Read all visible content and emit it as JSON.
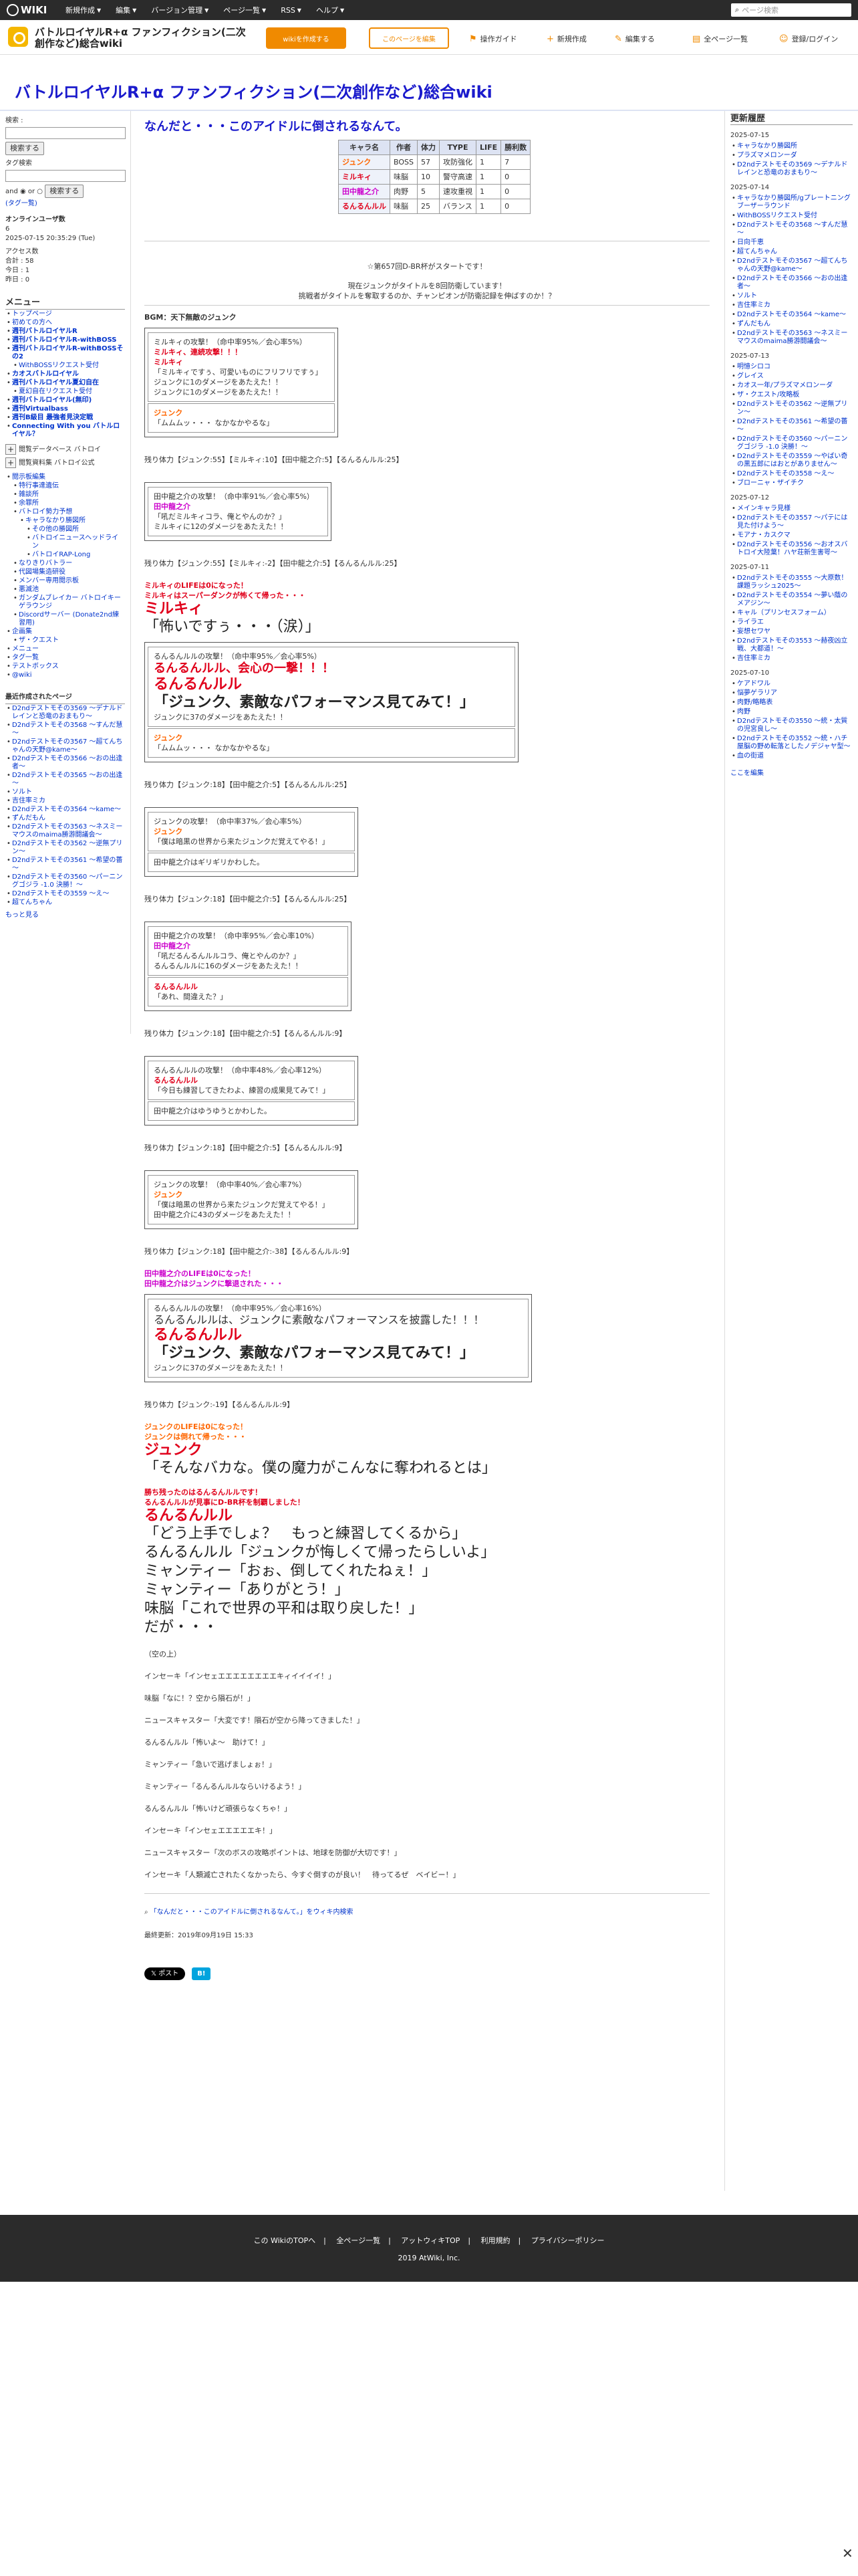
{
  "topbar": {
    "logo": "WIKI",
    "menus": [
      "新規作成",
      "編集",
      "バージョン管理",
      "ページ一覧",
      "RSS",
      "ヘルプ"
    ],
    "search_placeholder": "ページ検索"
  },
  "header": {
    "wiki_name": "バトルロイヤルR+α ファンフィクション(二次創作など)総合wiki",
    "btn_new_wiki": "wikiを作成する",
    "btn_edit_page": "このページを編集",
    "tools": [
      "操作ガイド",
      "新規作成",
      "編集する",
      "全ページ一覧",
      "登録/ログイン"
    ]
  },
  "page_title": "バトルロイヤルR+α ファンフィクション(二次創作など)総合wiki",
  "left": {
    "search_label": "検索 :",
    "search_btn": "検索する",
    "tag_label": "タグ検索",
    "tag_btn": "検索する",
    "and_or": "and ◉ or ○",
    "tag_cloud": "(タグ一覧)",
    "online_title": "オンラインユーザ数",
    "online_count": "6",
    "datetime": "2025-07-15 20:35:29 (Tue)",
    "access_title": "アクセス数",
    "access": [
      "合計 : 58",
      "今日 : 1",
      "昨日 : 0"
    ],
    "menu_title": "メニュー",
    "menu_items": [
      {
        "t": "トップページ",
        "b": false
      },
      {
        "t": "初めての方へ",
        "b": false
      },
      {
        "t": "週刊バトルロイヤルR",
        "b": true
      },
      {
        "t": "週刊バトルロイヤルR-withBOSS",
        "b": true
      },
      {
        "t": "週刊バトルロイヤルR-withBOSSその2",
        "b": true
      },
      {
        "t": "WithBOSSリクエスト受付",
        "b": false
      },
      {
        "t": "カオスバトルロイヤル",
        "b": true
      },
      {
        "t": "週刊バトルロイヤル夏幻自在",
        "b": true
      },
      {
        "t": "夏幻自在リクエスト受付",
        "b": false
      },
      {
        "t": "週刊バトルロイヤル(無印)",
        "b": true
      },
      {
        "t": "週刊Virtualbass",
        "b": true
      },
      {
        "t": "週刊B級目 最強者見決定戦",
        "b": true
      },
      {
        "t": "Connecting With you バトルロイヤル？",
        "b": true
      }
    ],
    "expand": "閲覧データベース バトロイ",
    "expand2": "閲覧資料集 バトロイ公式",
    "sub_items": [
      "閲示板編集",
      "特行事達遺伝",
      "雑談所",
      "余罪所",
      "バトロイ勢力予想",
      "キャラなかり勝図所",
      "その他の勝図所",
      "バトロイニュースヘッドライン",
      "バトロイRAP-Long",
      "なりきりバトラー",
      "代図場集造研役",
      "メンバー専用閲示板",
      "悪滅池",
      "ガンダムブレイカー バトロイキーゲラウンジ",
      "Discordサーバー (Donate2nd練習用)",
      "企画集",
      "ザ・クエスト",
      "メニュー",
      "タグ一覧",
      "テストボックス",
      "@wiki"
    ],
    "recent_title": "最近作成されたページ",
    "recent": [
      "D2ndテストモその3569 ～デナルドレインと恐竜のおまもり～",
      "D2ndテストモその3568 ～すんだ慧～",
      "D2ndテストモその3567 ～超てんちゃんの天野@kame～",
      "D2ndテストモその3566 ～おの出逢者～",
      "D2ndテストモその3565 ～おの出逢～",
      "ソルト",
      "吉住率ミカ",
      "D2ndテストモその3564 ～kame～",
      "ずんだもん",
      "D2ndテストモその3563 ～ネスミーマウスのmaima勝游闘議会～",
      "D2ndテストモその3562 ～逆無プリン～",
      "D2ndテストモその3561 ～希望の薔～",
      "D2ndテストモその3560 ～パーニングゴジラ -1.0 決勝！～",
      "D2ndテストモその3559 ～え～",
      "超てんちゃん"
    ],
    "more": "もっと見る"
  },
  "main": {
    "title": "なんだと・・・このアイドルに倒されるなんて。",
    "table": {
      "headers": [
        "キャラ名",
        "作者",
        "体力",
        "TYPE",
        "LIFE",
        "勝利数"
      ],
      "rows": [
        [
          "ジュンク",
          "BOSS",
          "57",
          "攻防強化",
          "1",
          "7"
        ],
        [
          "ミルキィ",
          "味脳",
          "10",
          "警守高速",
          "1",
          "0"
        ],
        [
          "田中龍之介",
          "肉野",
          "5",
          "速攻重視",
          "1",
          "0"
        ],
        [
          "るんるんルル",
          "味脳",
          "25",
          "バランス",
          "1",
          "0"
        ]
      ]
    },
    "start": "☆第657回D-BR杯がスタートです！",
    "current1": "現在ジュンクがタイトルを8回防衛しています！",
    "current2": "挑戦者がタイトルを奪取するのか、チャンピオンが防衛記録を伸ばすのか！？",
    "bgm": "BGM：天下無敵のジュンク",
    "box1": [
      "ミルキィの攻撃！（命中率95%／会心率5%）",
      "ミルキィ、連続攻撃！！！",
      "ミルキィ",
      "「ミルキィですぅ、可愛いものにフリフリですぅ」",
      "ジュンクに1のダメージをあたえた！！",
      "ジュンクに1のダメージをあたえた！！"
    ],
    "box1b": [
      "ジュンク",
      "「ムムムッ・・・ なかなかやるな」"
    ],
    "hp1": "残り体力【ジュンク:55】【ミルキィ:10】【田中龍之介:5】【るんるんルル:25】",
    "box2": [
      "田中龍之介の攻撃！（命中率91%／会心率5%）",
      "田中龍之介",
      "「吼だミルキィコラ、俺とやんのか？」",
      "ミルキィに12のダメージをあたえた！！"
    ],
    "hp2": "残り体力【ジュンク:55】【ミルキィ:-2】【田中龍之介:5】【るんるんルル:25】",
    "ko1a": "ミルキィのLIFEは0になった！",
    "ko1b": "ミルキィはスーパーダンクが怖くて帰った・・・",
    "ko1c": "ミルキィ",
    "ko1d": "「怖いですぅ・・・（涙）」",
    "box3": [
      "るんるんルルの攻撃！（命中率95%／会心率5%）",
      "るんるんルル、会心の一撃！！！",
      "るんるんルル",
      "「ジュンク、素敵なパフォーマンス見てみて！」",
      "ジュンクに37のダメージをあたえた！！"
    ],
    "box3b": [
      "ジュンク",
      "「ムムムッ・・・ なかなかやるな」"
    ],
    "hp3": "残り体力【ジュンク:18】【田中龍之介:5】【るんるんルル:25】",
    "box4": [
      "ジュンクの攻撃！（命中率37%／会心率5%）",
      "ジュンク",
      "「僕は暗黒の世界から来たジュンクだ覚えてやる！」"
    ],
    "box4b": "田中龍之介はギリギリかわした。",
    "hp4": "残り体力【ジュンク:18】【田中龍之介:5】【るんるんルル:25】",
    "box5": [
      "田中龍之介の攻撃！（命中率95%／会心率10%）",
      "田中龍之介",
      "「吼だるんるんルルコラ、俺とやんのか？」",
      "るんるんルルに16のダメージをあたえた！！"
    ],
    "box5b": [
      "るんるんルル",
      "「あれ、間違えた？」"
    ],
    "hp5": "残り体力【ジュンク:18】【田中龍之介:5】【るんるんルル:9】",
    "box6": [
      "るんるんルルの攻撃！（命中率48%／会心率12%）",
      "るんるんルル",
      "「今日も練習してきたわよ、練習の成果見てみて！」"
    ],
    "box6b": "田中龍之介はゆうゆうとかわした。",
    "hp6": "残り体力【ジュンク:18】【田中龍之介:5】【るんるんルル:9】",
    "box7": [
      "ジュンクの攻撃！（命中率40%／会心率7%）",
      "ジュンク",
      "「僕は暗黒の世界から来たジュンクだ覚えてやる！」",
      "田中龍之介に43のダメージをあたえた！！"
    ],
    "hp7": "残り体力【ジュンク:18】【田中龍之介:-38】【るんるんルル:9】",
    "ko2a": "田中龍之介のLIFEは0になった！",
    "ko2b": "田中龍之介はジュンクに撃退された・・・",
    "box8": [
      "るんるんルルの攻撃！（命中率95%／会心率16%）",
      "るんるんルルは、ジュンクに素敵なパフォーマンスを披露した！！！",
      "るんるんルル",
      "「ジュンク、素敵なパフォーマンス見てみて！」",
      "ジュンクに37のダメージをあたえた！！"
    ],
    "hp8": "残り体力【ジュンク:-19】【るんるんルル:9】",
    "ko3a": "ジュンクのLIFEは0になった！",
    "ko3b": "ジュンクは倒れて帰った・・・",
    "ko3c": "ジュンク",
    "ko3d": "「そんなバカな。僕の魔力がこんなに奪われるとは」",
    "win1": "勝ち残ったのはるんるんルルです！",
    "win2": "るんるんルルが見事にD-BR杯を制覇しました！",
    "end_lines": [
      "るんるんルル",
      "「どう上手でしょ？　もっと練習してくるから」",
      "るんるんルル「ジュンクが悔しくて帰ったらしいよ」",
      "ミャンティー「おぉ、倒してくれたねぇ！」",
      "ミャンティー「ありがとう！」",
      "味脳「これで世界の平和は取り戻した！」",
      "だが・・・"
    ],
    "post": [
      "（空の上）",
      "インセーキ「インセェエエエエエエエエキィイイイイ！」",
      "味脳「なに！？空から隕石が！」",
      "ニュースキャスター「大変です！隕石が空から降ってきました！」",
      "るんるんルル「怖いよ～　助けて！」",
      "ミャンティー「急いで逃げましょぉ！」",
      "ミャンティー「るんるんルルならいけるよう！」",
      "るんるんルル「怖いけど頑張らなくちゃ！」",
      "インセーキ「インセェエエエエエキ！」",
      "ニュースキャスター「次のボスの攻略ポイントは、地球を防御が大切です！」",
      "インセーキ「人類滅亡されたくなかったら、今すぐ倒すのが良い！　待ってるぜ　ベイビー！」"
    ],
    "wiki_note": "「なんだと・・・このアイドルに倒されるなんて。」をウィキ内検索",
    "updated": "最終更新：2019年09月19日 15:33",
    "share_x": "ポスト",
    "share_h": "B!"
  },
  "right": {
    "title": "更新履歴",
    "groups": [
      {
        "date": "2025-07-15",
        "items": [
          "キャラなかり勝図所",
          "プラズマメロンーダ",
          "D2ndテストモその3569 ～デナルドレインと恐竜のおまもり～"
        ]
      },
      {
        "date": "2025-07-14",
        "items": [
          "キャラなかり勝図所/gプレートニングブーザーラウンド",
          "WithBOSSリクエスト受付",
          "D2ndテストモその3568 ～すんだ慧～",
          "日向千恵",
          "超てんちゃん",
          "D2ndテストモその3567 ～超てんちゃんの天野@kame～",
          "D2ndテストモその3566 ～おの出逢者～",
          "ソルト",
          "吉住率ミカ",
          "D2ndテストモその3564 ～kame～",
          "ずんだもん",
          "D2ndテストモその3563 ～ネスミーマウスのmaima勝游闘議会～"
        ]
      },
      {
        "date": "2025-07-13",
        "items": [
          "明憶シロコ",
          "グレイス",
          "カオス一年/プラズマメロンーダ",
          "ザ・クエスト/攻略板",
          "D2ndテストモその3562 ～逆無プリン～",
          "D2ndテストモその3561 ～希望の薔～",
          "D2ndテストモその3560 ～パーニングゴジラ -1.0 決勝！～",
          "D2ndテストモその3559 ～やばい奇の黒五郎にはおとがありません～",
          "D2ndテストモその3558 ～え～",
          "ブローニャ・ザイチク"
        ]
      },
      {
        "date": "2025-07-12",
        "items": [
          "メインキャラ見様",
          "D2ndテストモその3557 ～パテには見た付けよう～",
          "モアナ・カスクマ",
          "D2ndテストモその3556 ～おオスバトロイ大陸葉！ハヤ荘新生害咢～"
        ]
      },
      {
        "date": "2025-07-11",
        "items": [
          "D2ndテストモその3555 ～大原数！課題ラッシュ2025～",
          "D2ndテストモその3554 ～夢い蔭のメアジン～",
          "キャル（プリンセスフォーム）",
          "ライラエ",
          "妄想セワヤ",
          "D2ndテストモその3553 ～赫夜凶立戦、大都道！～",
          "吉住率ミカ"
        ]
      },
      {
        "date": "2025-07-10",
        "items": [
          "ケアドワル",
          "悩夢ゲラリア",
          "肉野/略略表",
          "肉野",
          "D2ndテストモその3550 ～統・太質の児宮良し～",
          "D2ndテストモその3552 ～統・ハチ屋脳の野め転落としたノデジャヤ型～",
          "血の街道"
        ]
      }
    ],
    "more": "ここを編集"
  },
  "footer": {
    "links": [
      "この WikiのTOPへ",
      "全ページ一覧",
      "アットウィキTOP",
      "利用規約",
      "プライバシーポリシー"
    ],
    "copy": "2019 AtWiki, Inc."
  }
}
